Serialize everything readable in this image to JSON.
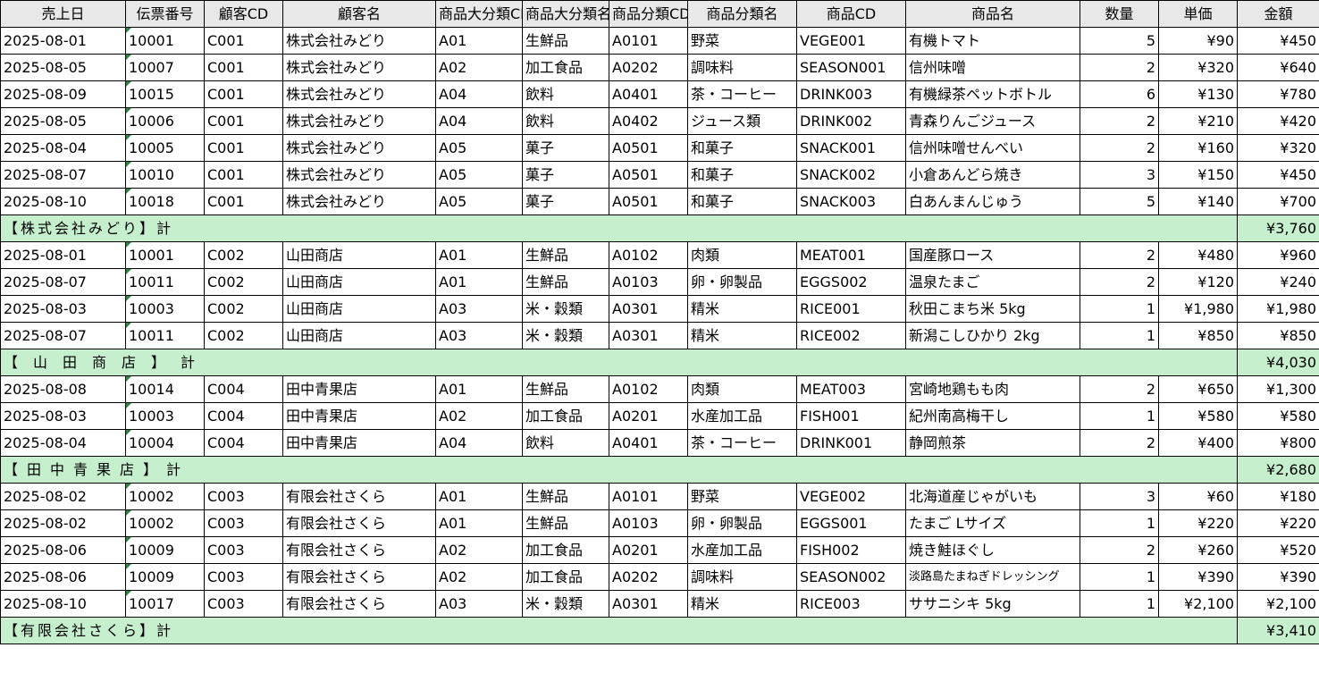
{
  "headers": [
    "売上日",
    "伝票番号",
    "顧客CD",
    "顧客名",
    "商品大分類CD",
    "商品大分類名",
    "商品分類CD",
    "商品分類名",
    "商品CD",
    "商品名",
    "数量",
    "単価",
    "金額"
  ],
  "groups": [
    {
      "rows": [
        [
          "2025-08-01",
          "10001",
          "C001",
          "株式会社みどり",
          "A01",
          "生鮮品",
          "A0101",
          "野菜",
          "VEGE001",
          "有機トマト",
          "5",
          "¥90",
          "¥450"
        ],
        [
          "2025-08-05",
          "10007",
          "C001",
          "株式会社みどり",
          "A02",
          "加工食品",
          "A0202",
          "調味料",
          "SEASON001",
          "信州味噌",
          "2",
          "¥320",
          "¥640"
        ],
        [
          "2025-08-09",
          "10015",
          "C001",
          "株式会社みどり",
          "A04",
          "飲料",
          "A0401",
          "茶・コーヒー",
          "DRINK003",
          "有機緑茶ペットボトル",
          "6",
          "¥130",
          "¥780"
        ],
        [
          "2025-08-05",
          "10006",
          "C001",
          "株式会社みどり",
          "A04",
          "飲料",
          "A0402",
          "ジュース類",
          "DRINK002",
          "青森りんごジュース",
          "2",
          "¥210",
          "¥420"
        ],
        [
          "2025-08-04",
          "10005",
          "C001",
          "株式会社みどり",
          "A05",
          "菓子",
          "A0501",
          "和菓子",
          "SNACK001",
          "信州味噌せんべい",
          "2",
          "¥160",
          "¥320"
        ],
        [
          "2025-08-07",
          "10010",
          "C001",
          "株式会社みどり",
          "A05",
          "菓子",
          "A0501",
          "和菓子",
          "SNACK002",
          "小倉あんどら焼き",
          "3",
          "¥150",
          "¥450"
        ],
        [
          "2025-08-10",
          "10018",
          "C001",
          "株式会社みどり",
          "A05",
          "菓子",
          "A0501",
          "和菓子",
          "SNACK003",
          "白あんまんじゅう",
          "5",
          "¥140",
          "¥700"
        ]
      ],
      "subtotal_label": "【株式会社みどり】計",
      "subtotal_spacing": "3px",
      "subtotal_value": "¥3,760"
    },
    {
      "rows": [
        [
          "2025-08-01",
          "10001",
          "C002",
          "山田商店",
          "A01",
          "生鮮品",
          "A0102",
          "肉類",
          "MEAT001",
          "国産豚ロース",
          "2",
          "¥480",
          "¥960"
        ],
        [
          "2025-08-07",
          "10011",
          "C002",
          "山田商店",
          "A01",
          "生鮮品",
          "A0103",
          "卵・卵製品",
          "EGGS002",
          "温泉たまご",
          "2",
          "¥120",
          "¥240"
        ],
        [
          "2025-08-03",
          "10003",
          "C002",
          "山田商店",
          "A03",
          "米・穀類",
          "A0301",
          "精米",
          "RICE001",
          "秋田こまち米 5kg",
          "1",
          "¥1,980",
          "¥1,980"
        ],
        [
          "2025-08-07",
          "10011",
          "C002",
          "山田商店",
          "A03",
          "米・穀類",
          "A0301",
          "精米",
          "RICE002",
          "新潟こしひかり 2kg",
          "1",
          "¥850",
          "¥850"
        ]
      ],
      "subtotal_label": "【山田商店】計",
      "subtotal_spacing": "17px",
      "subtotal_value": "¥4,030"
    },
    {
      "rows": [
        [
          "2025-08-08",
          "10014",
          "C004",
          "田中青果店",
          "A01",
          "生鮮品",
          "A0102",
          "肉類",
          "MEAT003",
          "宮崎地鶏もも肉",
          "2",
          "¥650",
          "¥1,300"
        ],
        [
          "2025-08-03",
          "10003",
          "C004",
          "田中青果店",
          "A02",
          "加工食品",
          "A0201",
          "水産加工品",
          "FISH001",
          "紀州南高梅干し",
          "1",
          "¥580",
          "¥580"
        ],
        [
          "2025-08-04",
          "10004",
          "C004",
          "田中青果店",
          "A04",
          "飲料",
          "A0401",
          "茶・コーヒー",
          "DRINK001",
          "静岡煎茶",
          "2",
          "¥400",
          "¥800"
        ]
      ],
      "subtotal_label": "【田中青果店】計",
      "subtotal_spacing": "10px",
      "subtotal_value": "¥2,680"
    },
    {
      "rows": [
        [
          "2025-08-02",
          "10002",
          "C003",
          "有限会社さくら",
          "A01",
          "生鮮品",
          "A0101",
          "野菜",
          "VEGE002",
          "北海道産じゃがいも",
          "3",
          "¥60",
          "¥180"
        ],
        [
          "2025-08-02",
          "10002",
          "C003",
          "有限会社さくら",
          "A01",
          "生鮮品",
          "A0103",
          "卵・卵製品",
          "EGGS001",
          "たまご Lサイズ",
          "1",
          "¥220",
          "¥220"
        ],
        [
          "2025-08-06",
          "10009",
          "C003",
          "有限会社さくら",
          "A02",
          "加工食品",
          "A0201",
          "水産加工品",
          "FISH002",
          "焼き鮭ほぐし",
          "2",
          "¥260",
          "¥520"
        ],
        [
          "2025-08-06",
          "10009",
          "C003",
          "有限会社さくら",
          "A02",
          "加工食品",
          "A0202",
          "調味料",
          "SEASON002",
          "淡路島たまねぎドレッシング",
          "1",
          "¥390",
          "¥390"
        ],
        [
          "2025-08-10",
          "10017",
          "C003",
          "有限会社さくら",
          "A03",
          "米・穀類",
          "A0301",
          "精米",
          "RICE003",
          "ササニシキ 5kg",
          "1",
          "¥2,100",
          "¥2,100"
        ]
      ],
      "subtotal_label": "【有限会社さくら】計",
      "subtotal_spacing": "3px",
      "subtotal_value": "¥3,410"
    }
  ]
}
